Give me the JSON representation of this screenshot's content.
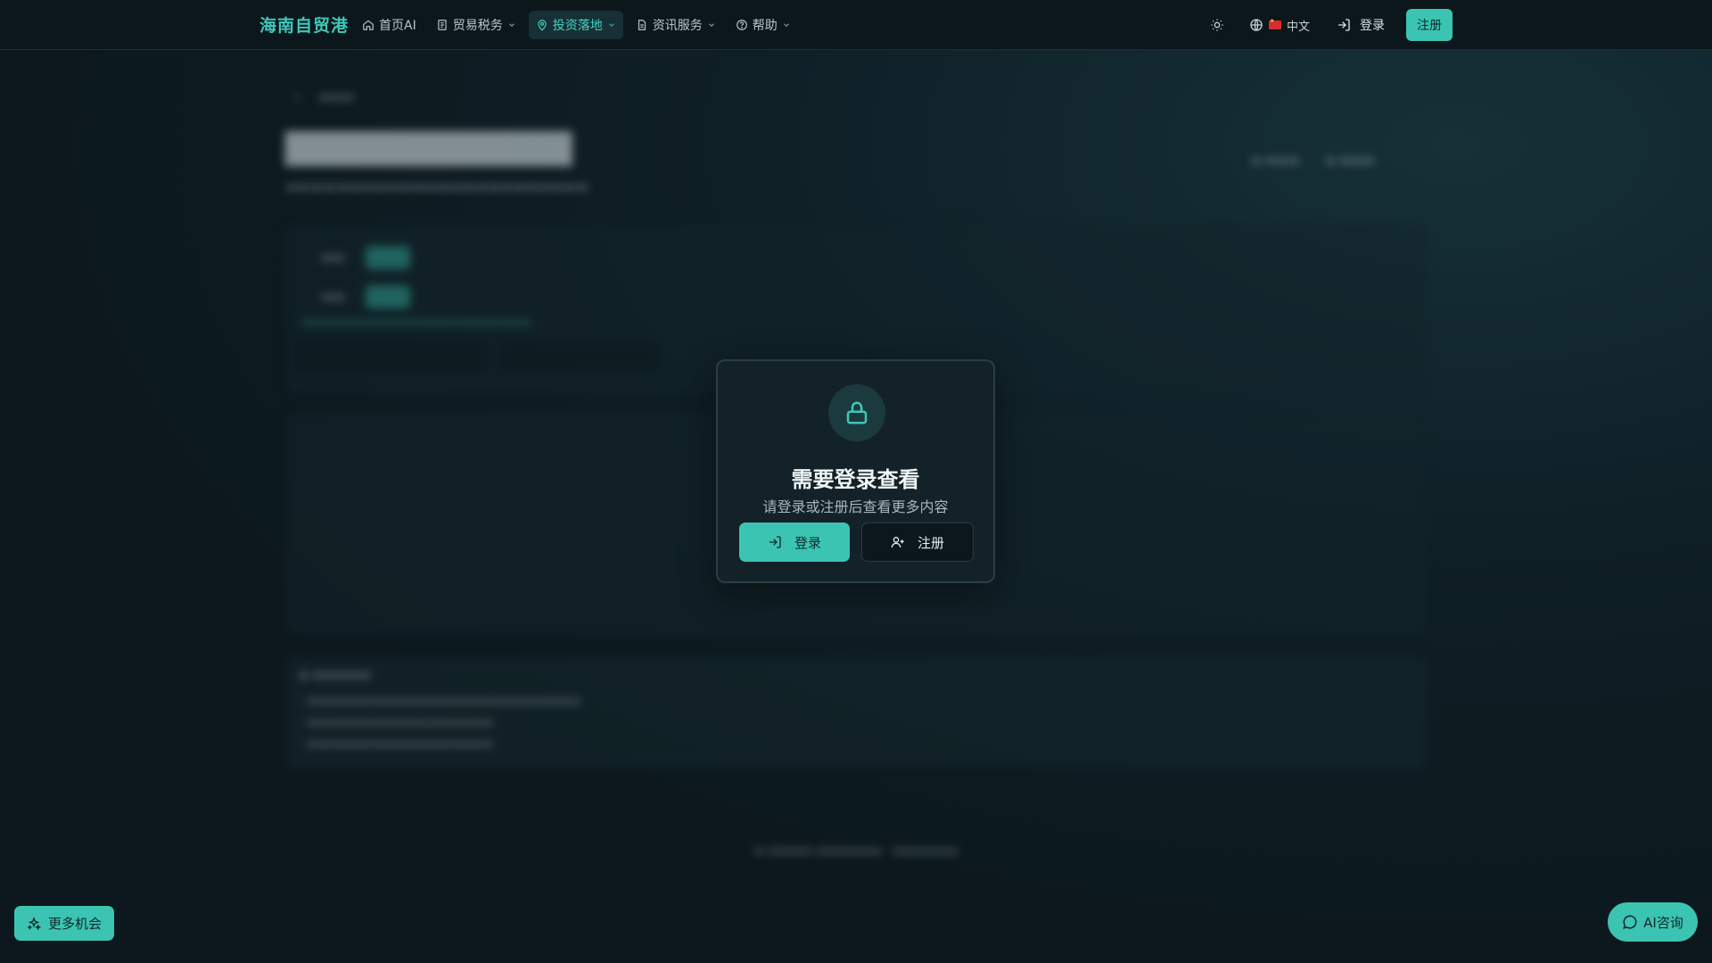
{
  "brand": "海南自贸港",
  "nav": {
    "items": [
      {
        "label": "首页AI",
        "icon": "home-icon"
      },
      {
        "label": "贸易税务",
        "icon": "receipt-icon"
      },
      {
        "label": "投资落地",
        "icon": "map-pin-icon"
      },
      {
        "label": "资讯服务",
        "icon": "document-icon"
      },
      {
        "label": "帮助",
        "icon": "help-circle-icon"
      }
    ],
    "active_index": 2,
    "language": "中文",
    "login": "登录",
    "register": "注册"
  },
  "modal": {
    "title": "需要登录查看",
    "subtitle": "请登录或注册后查看更多内容",
    "login": "登录",
    "register": "注册"
  },
  "floating": {
    "more": "更多机会",
    "ai": "AI咨询"
  },
  "colors": {
    "accent": "#3cc4b3",
    "background": "#0d1a20",
    "modal_bg": "#132228"
  }
}
